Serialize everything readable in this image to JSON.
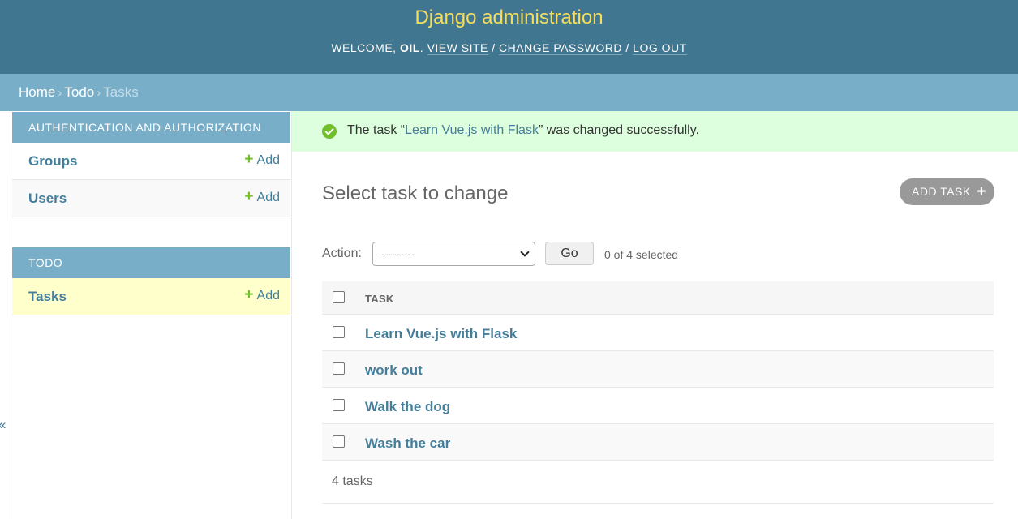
{
  "header": {
    "site_name": "Django administration",
    "welcome": "Welcome,",
    "username": "oil",
    "view_site": "View site",
    "change_password": "Change password",
    "log_out": "Log out"
  },
  "breadcrumbs": {
    "home": "Home",
    "app": "Todo",
    "current": "Tasks"
  },
  "sidebar": {
    "toggle_glyph": "«",
    "modules": [
      {
        "caption": "Authentication and Authorization",
        "models": [
          {
            "name": "Groups",
            "add": "Add"
          },
          {
            "name": "Users",
            "add": "Add"
          }
        ]
      },
      {
        "caption": "Todo",
        "models": [
          {
            "name": "Tasks",
            "add": "Add"
          }
        ]
      }
    ]
  },
  "message": {
    "prefix": "The task “",
    "link": "Learn Vue.js with Flask",
    "suffix": "” was changed successfully."
  },
  "content": {
    "title": "Select task to change",
    "add_button": "Add task"
  },
  "actions": {
    "label": "Action:",
    "selected_option": "---------",
    "go": "Go",
    "counter": "0 of 4 selected"
  },
  "table": {
    "column": "Task",
    "rows": [
      "Learn Vue.js with Flask",
      "work out",
      "Walk the dog",
      "Wash the car"
    ],
    "footer": "4 tasks"
  },
  "colors": {
    "header_bg": "#417690",
    "brand_yellow": "#f5dd5d",
    "breadcrumb_bg": "#79aec8",
    "link": "#447e9b",
    "success_bg": "#ddffdd",
    "add_green": "#70bf2b"
  }
}
